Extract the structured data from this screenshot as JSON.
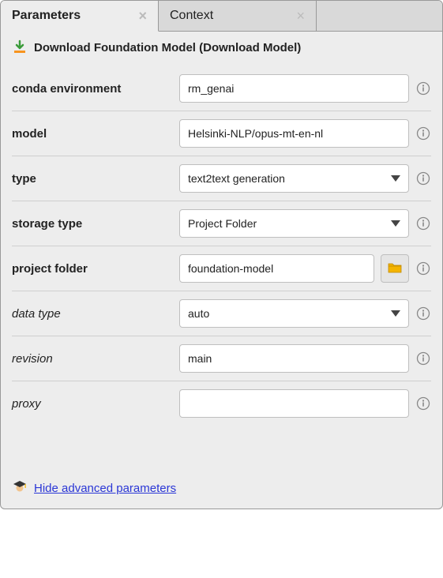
{
  "tabs": [
    {
      "label": "Parameters",
      "active": true
    },
    {
      "label": "Context",
      "active": false
    }
  ],
  "header": {
    "title": "Download Foundation Model (Download Model)"
  },
  "fields": {
    "conda_env": {
      "label": "conda environment",
      "value": "rm_genai",
      "type": "text",
      "advanced": false
    },
    "model": {
      "label": "model",
      "value": "Helsinki-NLP/opus-mt-en-nl",
      "type": "text",
      "advanced": false
    },
    "ftype": {
      "label": "type",
      "value": "text2text generation",
      "type": "select",
      "advanced": false
    },
    "storage": {
      "label": "storage type",
      "value": "Project Folder",
      "type": "select",
      "advanced": false
    },
    "project_folder": {
      "label": "project folder",
      "value": "foundation-model",
      "type": "folder",
      "advanced": false
    },
    "data_type": {
      "label": "data type",
      "value": "auto",
      "type": "select",
      "advanced": true
    },
    "revision": {
      "label": "revision",
      "value": "main",
      "type": "text",
      "advanced": true
    },
    "proxy": {
      "label": "proxy",
      "value": "",
      "type": "text",
      "advanced": true
    }
  },
  "footer": {
    "link": "Hide advanced parameters"
  }
}
